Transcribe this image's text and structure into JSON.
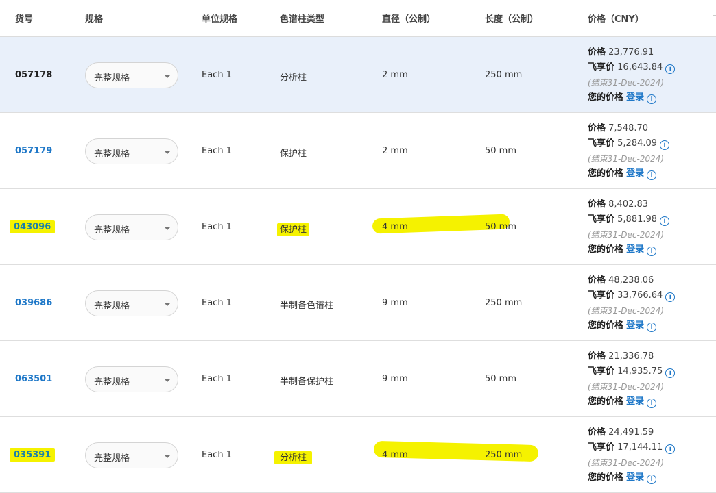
{
  "columns": {
    "item_no": "货号",
    "spec": "规格",
    "unit_spec": "单位规格",
    "column_type": "色谱柱类型",
    "diameter": "直径（公制）",
    "length": "长度（公制）",
    "price": "价格（CNY）"
  },
  "labels": {
    "price": "价格",
    "member_price": "飞享价",
    "your_price": "您的价格",
    "login": "登录"
  },
  "rows": [
    {
      "item": "057178",
      "spec": "完整规格",
      "unit": "Each 1",
      "type": "分析柱",
      "diameter": "2 mm",
      "length": "250 mm",
      "price": "23,776.91",
      "member": "16,643.84",
      "note": "(结束31-Dec-2024)"
    },
    {
      "item": "057179",
      "spec": "完整规格",
      "unit": "Each 1",
      "type": "保护柱",
      "diameter": "2 mm",
      "length": "50 mm",
      "price": "7,548.70",
      "member": "5,284.09",
      "note": "(结束31-Dec-2024)"
    },
    {
      "item": "043096",
      "spec": "完整规格",
      "unit": "Each 1",
      "type": "保护柱",
      "diameter": "4 mm",
      "length": "50 mm",
      "price": "8,402.83",
      "member": "5,881.98",
      "note": "(结束31-Dec-2024)"
    },
    {
      "item": "039686",
      "spec": "完整规格",
      "unit": "Each 1",
      "type": "半制备色谱柱",
      "diameter": "9 mm",
      "length": "250 mm",
      "price": "48,238.06",
      "member": "33,766.64",
      "note": "(结束31-Dec-2024)"
    },
    {
      "item": "063501",
      "spec": "完整规格",
      "unit": "Each 1",
      "type": "半制备保护柱",
      "diameter": "9 mm",
      "length": "50 mm",
      "price": "21,336.78",
      "member": "14,935.75",
      "note": "(结束31-Dec-2024)"
    },
    {
      "item": "035391",
      "spec": "完整规格",
      "unit": "Each 1",
      "type": "分析柱",
      "diameter": "4 mm",
      "length": "250 mm",
      "price": "24,491.59",
      "member": "17,144.11",
      "note": "(结束31-Dec-2024)"
    }
  ],
  "colors": {
    "link": "#1f78c8",
    "highlight": "#f5f200",
    "selected_row": "#e9f0fa"
  }
}
